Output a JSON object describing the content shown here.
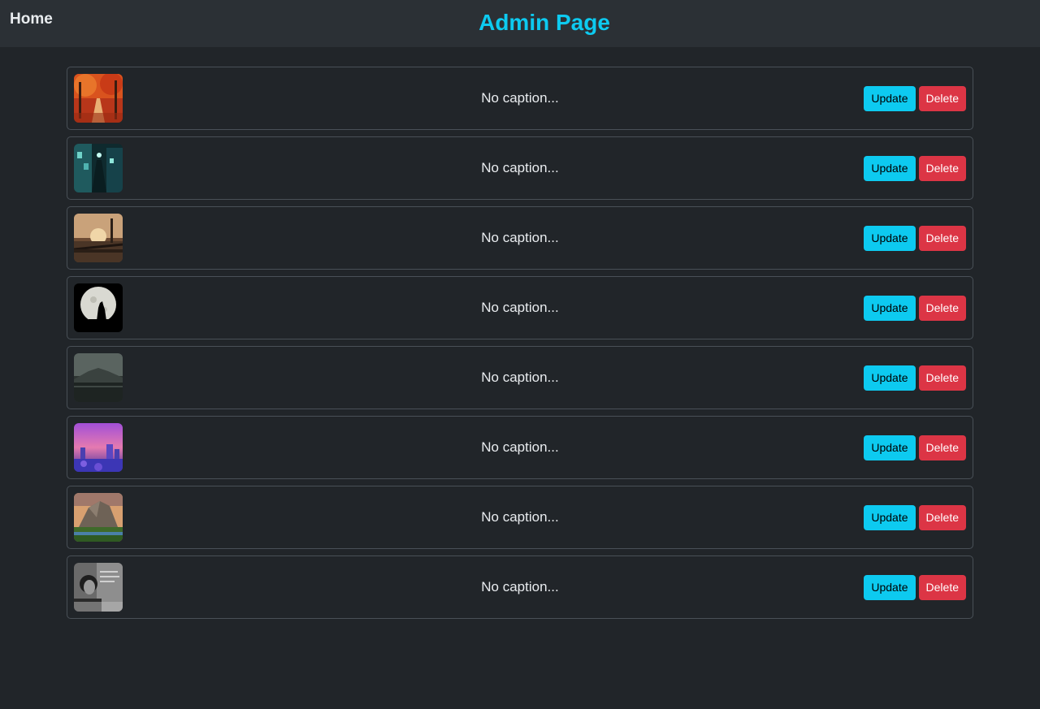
{
  "nav": {
    "home_label": "Home",
    "title": "Admin Page"
  },
  "colors": {
    "accent": "#0dcaf0",
    "danger": "#dc3545",
    "background": "#212529"
  },
  "posts": [
    {
      "thumb": "autumn-forest-path",
      "caption": "No caption...",
      "update_label": "Update",
      "delete_label": "Delete"
    },
    {
      "thumb": "neon-city-alley",
      "caption": "No caption...",
      "update_label": "Update",
      "delete_label": "Delete"
    },
    {
      "thumb": "sunset-promenade",
      "caption": "No caption...",
      "update_label": "Update",
      "delete_label": "Delete"
    },
    {
      "thumb": "wolf-howling-moon",
      "caption": "No caption...",
      "update_label": "Update",
      "delete_label": "Delete"
    },
    {
      "thumb": "misty-mountain-lake",
      "caption": "No caption...",
      "update_label": "Update",
      "delete_label": "Delete"
    },
    {
      "thumb": "purple-city-skyline",
      "caption": "No caption...",
      "update_label": "Update",
      "delete_label": "Delete"
    },
    {
      "thumb": "mountain-valley-sunset",
      "caption": "No caption...",
      "update_label": "Update",
      "delete_label": "Delete"
    },
    {
      "thumb": "monochrome-portrait",
      "caption": "No caption...",
      "update_label": "Update",
      "delete_label": "Delete"
    }
  ]
}
